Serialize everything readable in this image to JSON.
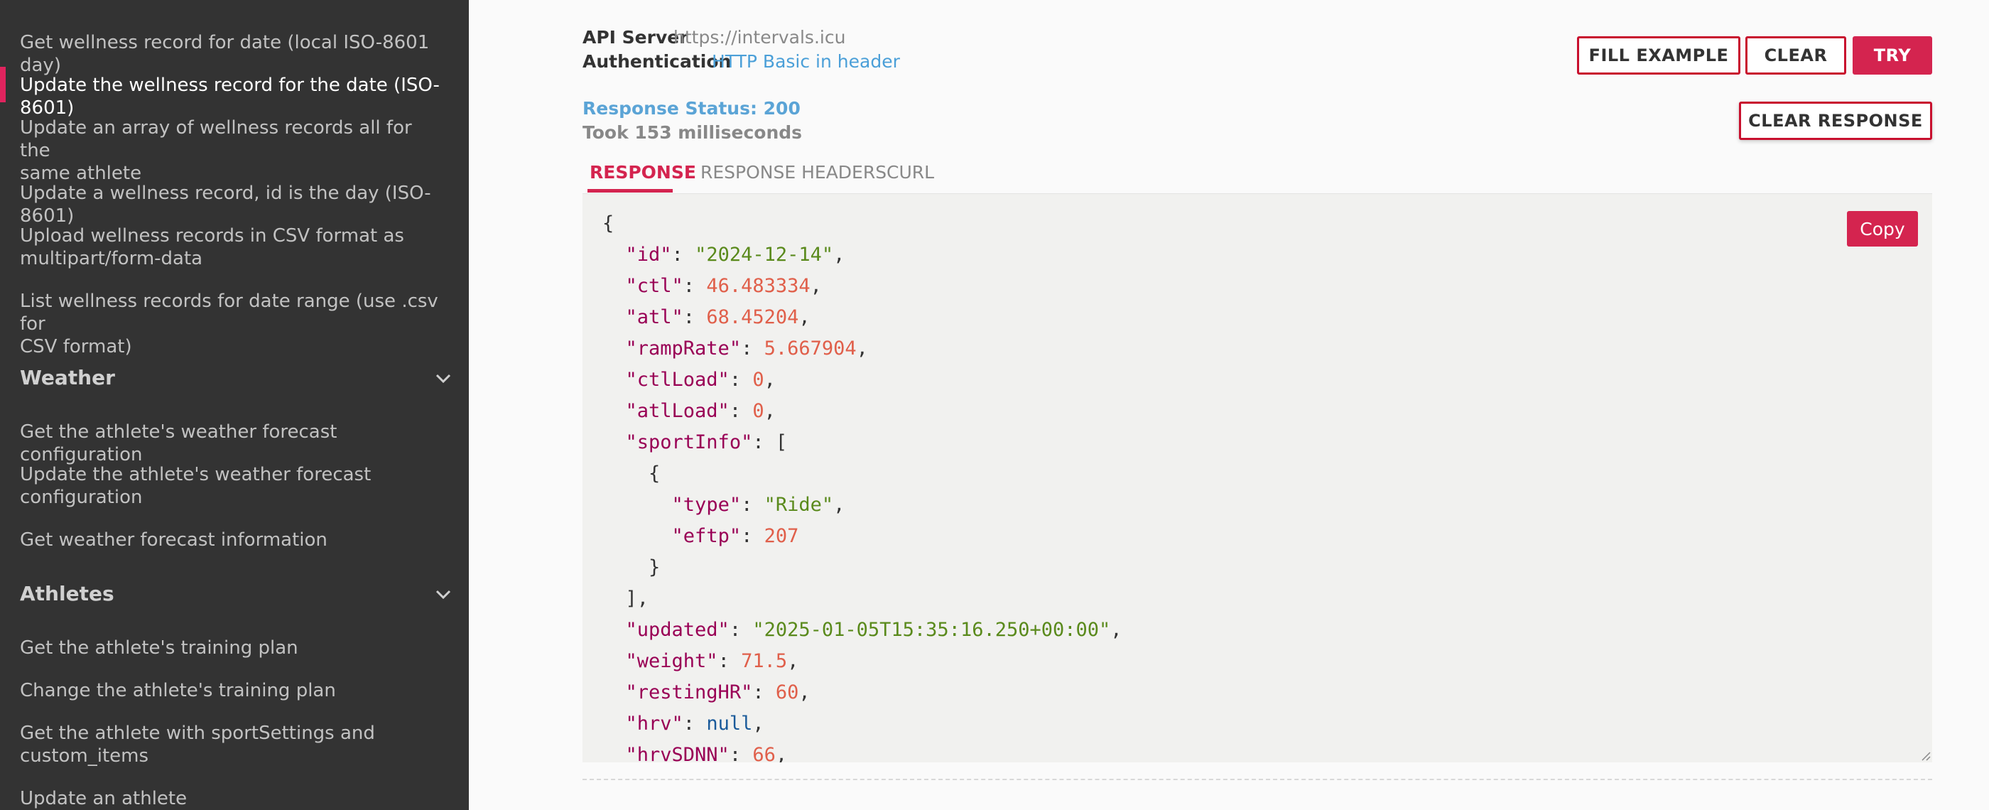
{
  "sidebar": {
    "items_top": [
      {
        "label": "Get wellness record for date (local ISO-8601 day)"
      },
      {
        "label": "Update the wellness record for the date (ISO-8601)"
      },
      {
        "label1": "Update an array of wellness records all for the",
        "label2": "same athlete"
      },
      {
        "label": "Update a wellness record, id is the day (ISO-8601)"
      },
      {
        "label1": "Upload wellness records in CSV format as",
        "label2": "multipart/form-data"
      },
      {
        "label1": "List wellness records for date range (use .csv for",
        "label2": "CSV format)"
      }
    ],
    "weather_header": "Weather",
    "weather_items": [
      {
        "label": "Get the athlete's weather forecast configuration"
      },
      {
        "label1": "Update the athlete's weather forecast",
        "label2": "configuration"
      },
      {
        "label": "Get weather forecast information"
      }
    ],
    "athletes_header": "Athletes",
    "athletes_items": [
      {
        "label": "Get the athlete's training plan"
      },
      {
        "label": "Change the athlete's training plan"
      },
      {
        "label1": "Get the athlete with sportSettings and",
        "label2": "custom_items"
      },
      {
        "label": "Update an athlete"
      }
    ]
  },
  "meta": {
    "api_server_label": "API Server",
    "api_server_value": "https://intervals.icu",
    "auth_label": "Authentication",
    "auth_value": "HTTP Basic in header"
  },
  "buttons": {
    "fill_example": "FILL EXAMPLE",
    "clear": "CLEAR",
    "try": "TRY",
    "clear_response": "CLEAR RESPONSE",
    "copy": "Copy"
  },
  "response": {
    "status": "Response Status: 200",
    "took": "Took 153 milliseconds"
  },
  "tabs": [
    "RESPONSE",
    "RESPONSE HEADERS",
    "CURL"
  ],
  "code": [
    [
      [
        "p",
        "{"
      ]
    ],
    [
      [
        "p",
        "  "
      ],
      [
        "k",
        "\"id\""
      ],
      [
        "p",
        ": "
      ],
      [
        "s",
        "\"2024-12-14\""
      ],
      [
        "p",
        ","
      ]
    ],
    [
      [
        "p",
        "  "
      ],
      [
        "k",
        "\"ctl\""
      ],
      [
        "p",
        ": "
      ],
      [
        "n",
        "46.483334"
      ],
      [
        "p",
        ","
      ]
    ],
    [
      [
        "p",
        "  "
      ],
      [
        "k",
        "\"atl\""
      ],
      [
        "p",
        ": "
      ],
      [
        "n",
        "68.45204"
      ],
      [
        "p",
        ","
      ]
    ],
    [
      [
        "p",
        "  "
      ],
      [
        "k",
        "\"rampRate\""
      ],
      [
        "p",
        ": "
      ],
      [
        "n",
        "5.667904"
      ],
      [
        "p",
        ","
      ]
    ],
    [
      [
        "p",
        "  "
      ],
      [
        "k",
        "\"ctlLoad\""
      ],
      [
        "p",
        ": "
      ],
      [
        "n",
        "0"
      ],
      [
        "p",
        ","
      ]
    ],
    [
      [
        "p",
        "  "
      ],
      [
        "k",
        "\"atlLoad\""
      ],
      [
        "p",
        ": "
      ],
      [
        "n",
        "0"
      ],
      [
        "p",
        ","
      ]
    ],
    [
      [
        "p",
        "  "
      ],
      [
        "k",
        "\"sportInfo\""
      ],
      [
        "p",
        ": ["
      ]
    ],
    [
      [
        "p",
        "    {"
      ]
    ],
    [
      [
        "p",
        "      "
      ],
      [
        "k",
        "\"type\""
      ],
      [
        "p",
        ": "
      ],
      [
        "s",
        "\"Ride\""
      ],
      [
        "p",
        ","
      ]
    ],
    [
      [
        "p",
        "      "
      ],
      [
        "k",
        "\"eftp\""
      ],
      [
        "p",
        ": "
      ],
      [
        "n",
        "207"
      ]
    ],
    [
      [
        "p",
        "    }"
      ]
    ],
    [
      [
        "p",
        "  ],"
      ]
    ],
    [
      [
        "p",
        "  "
      ],
      [
        "k",
        "\"updated\""
      ],
      [
        "p",
        ": "
      ],
      [
        "s",
        "\"2025-01-05T15:35:16.250+00:00\""
      ],
      [
        "p",
        ","
      ]
    ],
    [
      [
        "p",
        "  "
      ],
      [
        "k",
        "\"weight\""
      ],
      [
        "p",
        ": "
      ],
      [
        "n",
        "71.5"
      ],
      [
        "p",
        ","
      ]
    ],
    [
      [
        "p",
        "  "
      ],
      [
        "k",
        "\"restingHR\""
      ],
      [
        "p",
        ": "
      ],
      [
        "n",
        "60"
      ],
      [
        "p",
        ","
      ]
    ],
    [
      [
        "p",
        "  "
      ],
      [
        "k",
        "\"hrv\""
      ],
      [
        "p",
        ": "
      ],
      [
        "nl",
        "null"
      ],
      [
        "p",
        ","
      ]
    ],
    [
      [
        "p",
        "  "
      ],
      [
        "k",
        "\"hrvSDNN\""
      ],
      [
        "p",
        ": "
      ],
      [
        "n",
        "66"
      ],
      [
        "p",
        ","
      ]
    ]
  ]
}
